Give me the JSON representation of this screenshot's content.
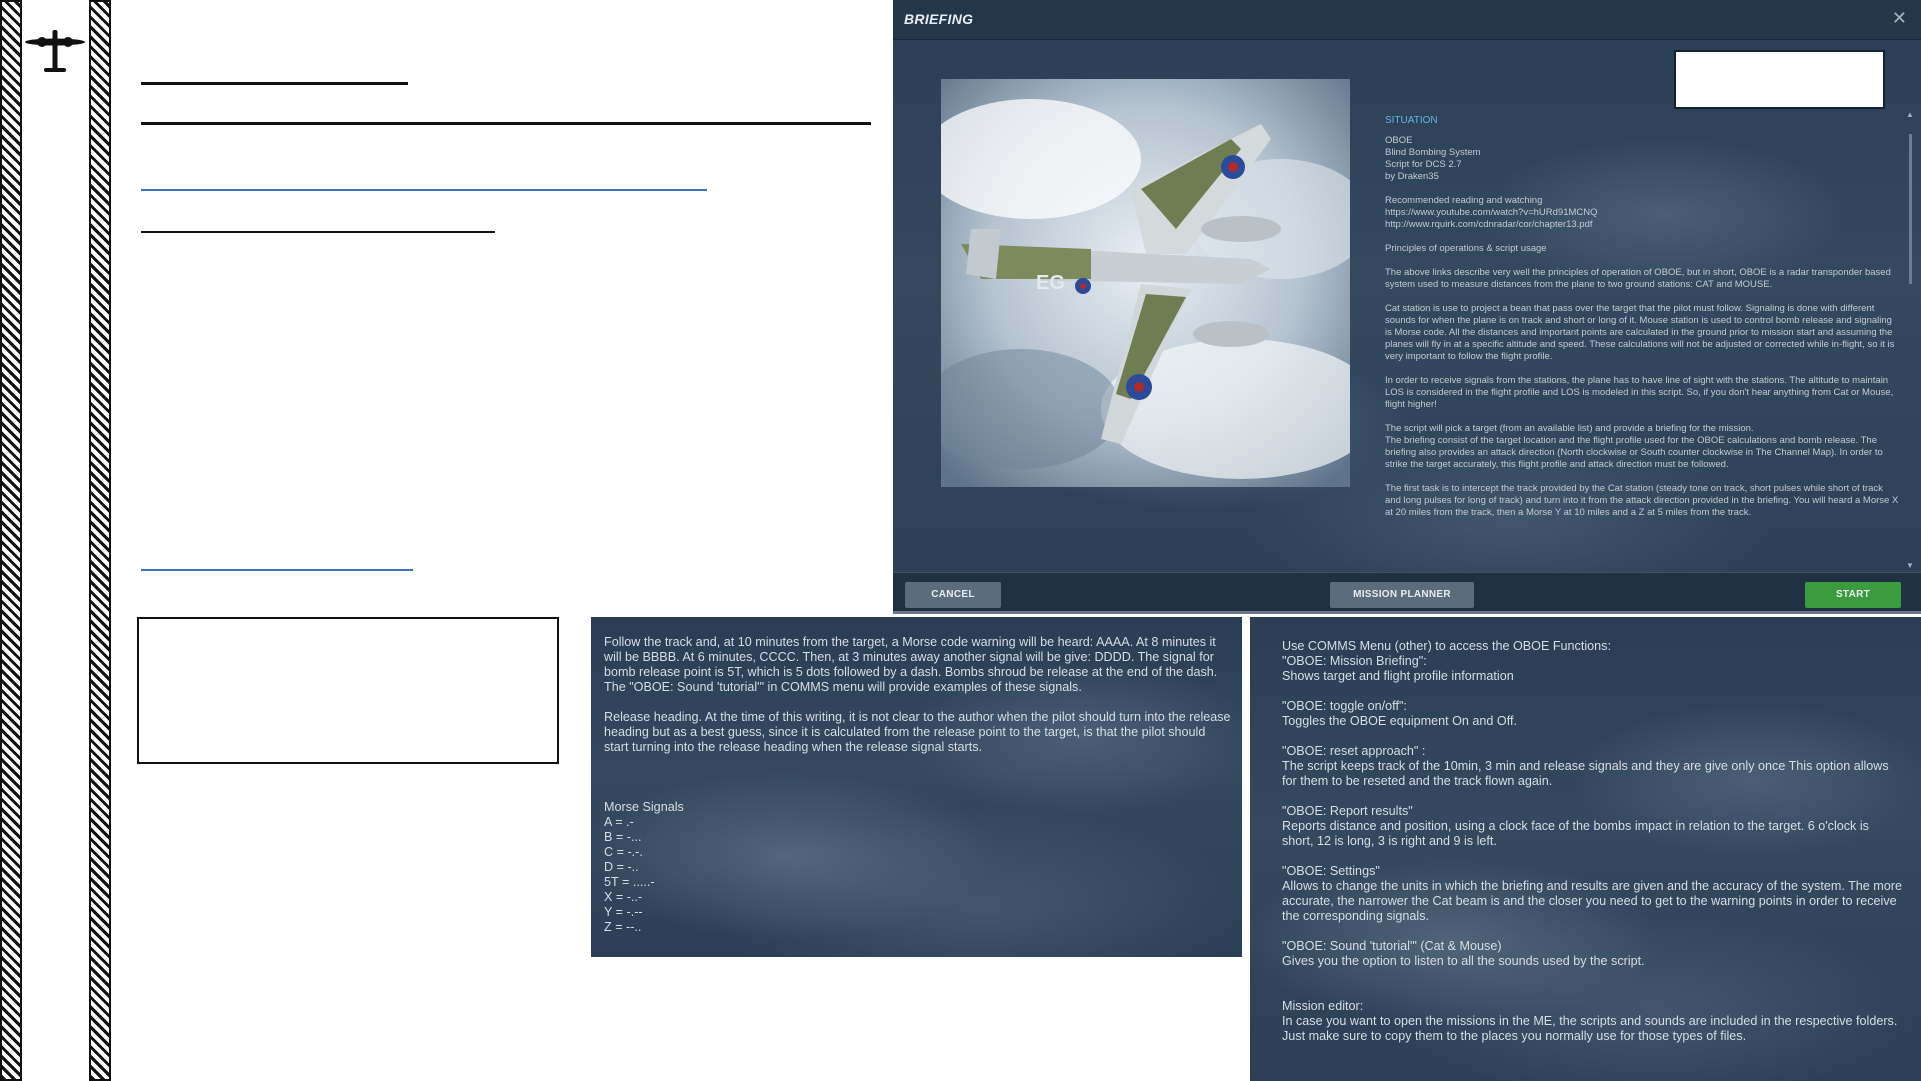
{
  "briefing": {
    "title": "BRIEFING",
    "close_symbol": "✕",
    "situation_heading": "SITUATION",
    "paragraphs": [
      "OBOE\nBlind Bombing System\nScript for DCS 2.7\nby Draken35",
      "Recommended reading and watching\nhttps://www.youtube.com/watch?v=hURd91MCNQ\nhttp://www.rquirk.com/cdnradar/cor/chapter13.pdf",
      "Principles of operations & script usage",
      "The above links describe very well the principles of operation of OBOE, but in short, OBOE is a radar transponder based system used to measure distances from the plane to two ground stations: CAT and MOUSE.",
      "Cat station is use to project a bean that pass over the target that the pilot must follow. Signaling is done with different sounds for when the plane is on track and short or long of it.  Mouse station is used to control bomb release and signaling is Morse code. All the distances and important points are calculated in the ground prior to mission start and assuming the planes will fly in at a specific altitude and speed. These calculations will not be adjusted or corrected while in-flight, so it is very important to follow the flight profile.",
      "In order to receive signals from the stations, the plane has to have line of sight with the stations. The altitude to maintain LOS is considered in the flight profile and LOS is modeled in this script. So, if you don't hear anything from Cat or Mouse, flight higher!",
      "The script will pick a target (from an available list) and provide a briefing for the mission.\nThe briefing consist of the target location and the flight profile used for the OBOE calculations and bomb release. The briefing also provides an attack direction (North clockwise or South counter clockwise in The Channel Map). In order to strike the target accurately, this flight profile and attack direction must be followed.",
      "The first task is to intercept the track provided by the Cat station (steady tone on track, short pulses while short of track and long pulses for long of track) and turn into it from the attack direction provided in the briefing. You will heard a Morse X at 20 miles from the track, then a Morse Y at 10 miles and a Z at 5 miles from the track."
    ],
    "buttons": {
      "cancel": "CANCEL",
      "mission_planner": "MISSION PLANNER",
      "start": "START"
    }
  },
  "center_panel": {
    "paragraph1": "Follow the track and, at 10 minutes from the target, a Morse code warning will be heard: AAAA. At 8 minutes it will be  BBBB. At 6 minutes, CCCC. Then, at 3 minutes away another signal will be give: DDDD. The signal for bomb release point is 5T, which  is 5 dots followed by a dash. Bombs shroud be release at the end of the dash. The \"OBOE: Sound 'tutorial'\" in COMMS menu will provide examples of these signals.",
    "paragraph2": "Release heading. At the time of this writing, it is not clear to the author when the pilot should turn into the release heading but as a best guess, since it is calculated from the release point to  the target, is that the pilot should start turning into the release heading when the release signal starts.",
    "morse_title": "Morse Signals",
    "morse": [
      "A = .-",
      "B = -...",
      "C = -.-.",
      "D = -..",
      "5T = .....-",
      "X = -..-",
      "Y = -.--",
      "Z = --.."
    ]
  },
  "right_panel": {
    "intro": "Use COMMS Menu (other) to access the OBOE Functions:",
    "items": [
      {
        "name": "\"OBOE: Mission Briefing\":",
        "desc": "    Shows target and flight profile information"
      },
      {
        "name": "\"OBOE: toggle on/off\":",
        "desc": "    Toggles the OBOE equipment On and Off."
      },
      {
        "name": "\"OBOE: reset approach\" :",
        "desc": "    The script keeps track of the 10min, 3 min and release signals and they are give only once     This option allows for them to be reseted and the track flown again."
      },
      {
        "name": "\"OBOE: Report results\"",
        "desc": "    Reports distance and position, using a clock face of the bombs impact in relation to the     target. 6 o'clock is short, 12 is long, 3 is right and 9 is left."
      },
      {
        "name": "\"OBOE: Settings\"",
        "desc": "    Allows to change the units in which the briefing and results are given and the accuracy of     the system.  The more accurate, the narrower the Cat beam is and the closer you need to get     to the warning points in order to receive the corresponding signals."
      },
      {
        "name": "\"OBOE: Sound 'tutorial'\" (Cat & Mouse)",
        "desc": "    Gives you the option to listen to all the sounds used by the script."
      }
    ],
    "editor_title": "Mission editor:",
    "editor_desc": "    In case you want to open the missions in the ME, the scripts and sounds are included in the respective folders. Just make sure to copy them to the places you normally use for those types of files."
  },
  "icons": {
    "plane": "plane-silhouette-icon",
    "photo": "mosquito-aircraft-photo"
  },
  "colors": {
    "accent_blue": "#5fb4e6",
    "start_green": "#3a9c3e",
    "link_blue": "#3f6fb5"
  }
}
